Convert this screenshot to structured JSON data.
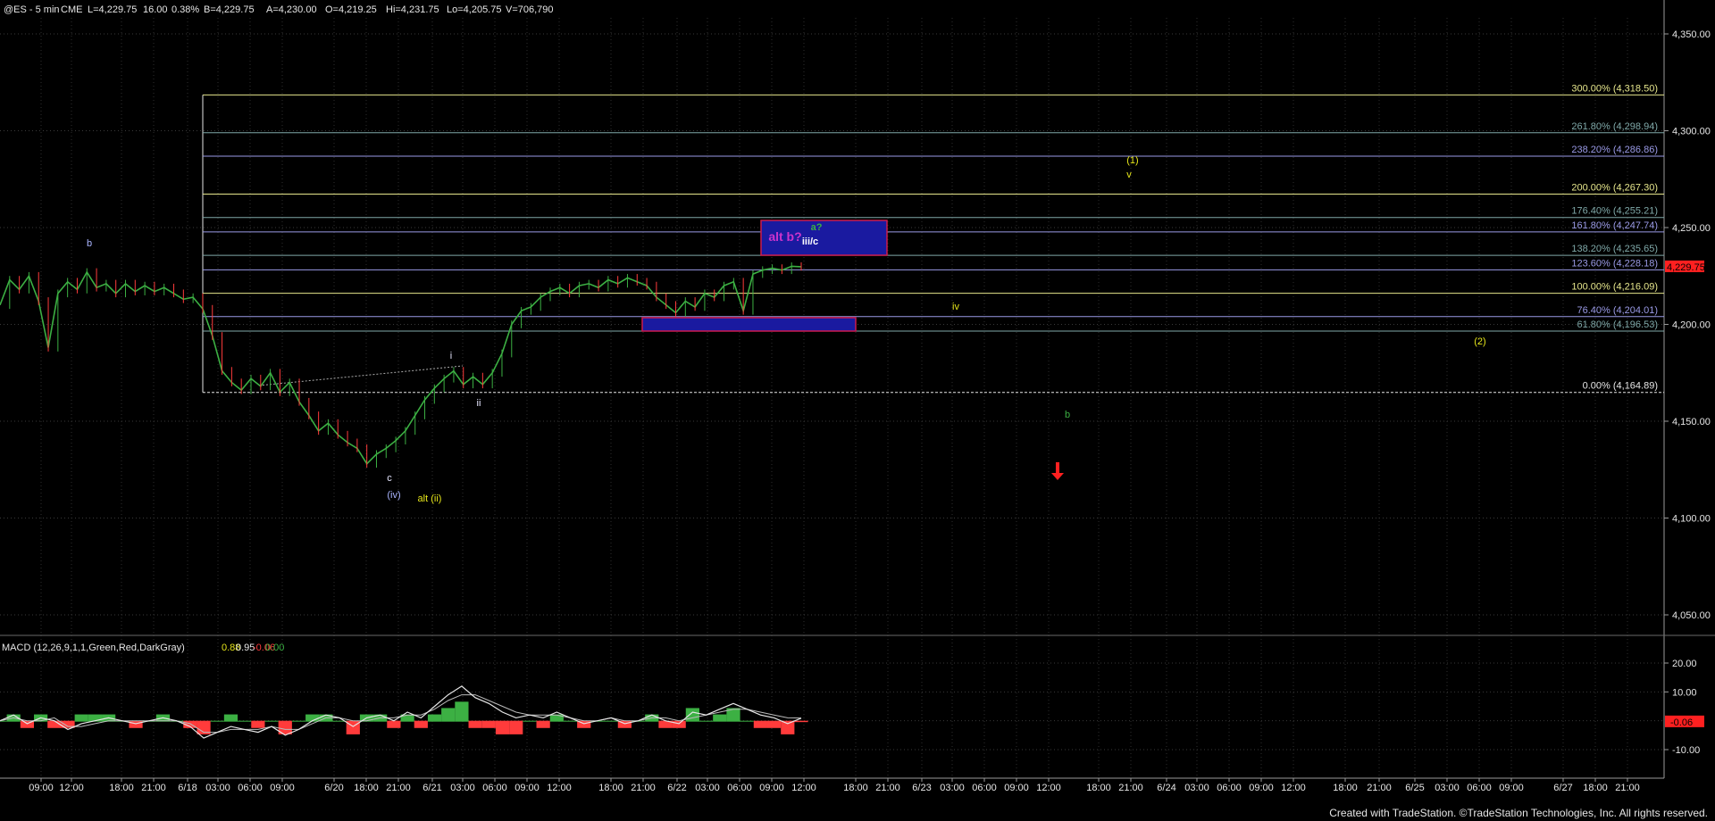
{
  "header": {
    "symbol": "@ES - 5 min",
    "exchange": "CME",
    "last": "L=4,229.75",
    "change": "16.00",
    "change_pct": "0.38%",
    "bid": "B=4,229.75",
    "ask": "A=4,230.00",
    "open": "O=4,219.25",
    "high": "Hi=4,231.75",
    "low": "Lo=4,205.75",
    "volume": "V=706,790"
  },
  "price_axis": {
    "ticks": [
      {
        "value": 4350,
        "label": "4,350.00"
      },
      {
        "value": 4300,
        "label": "4,300.00"
      },
      {
        "value": 4250,
        "label": "4,250.00"
      },
      {
        "value": 4200,
        "label": "4,200.00"
      },
      {
        "value": 4150,
        "label": "4,150.00"
      },
      {
        "value": 4100,
        "label": "4,100.00"
      },
      {
        "value": 4050,
        "label": "4,050.00"
      }
    ],
    "last_price_label": "4,229.75",
    "min": 4030,
    "max": 4370
  },
  "macd": {
    "title": "MACD (12,26,9,1,1,Green,Red,DarkGray)",
    "values": [
      "0.88",
      "0.95",
      "-0.06",
      "0.00"
    ],
    "value_colors": [
      "#e6e61a",
      "#e6e6e6",
      "#ff3b3b",
      "#3cb043"
    ],
    "ticks": [
      {
        "value": 20,
        "label": "20.00"
      },
      {
        "value": 10,
        "label": "10.00"
      },
      {
        "value": -10,
        "label": "-10.00"
      }
    ],
    "current_label": "-0.06",
    "min": -16,
    "max": 25
  },
  "time_axis": {
    "labels": [
      "09:00",
      "12:00",
      "18:00",
      "21:00",
      "6/18",
      "03:00",
      "06:00",
      "09:00",
      "6/20",
      "18:00",
      "21:00",
      "6/21",
      "03:00",
      "06:00",
      "09:00",
      "12:00",
      "18:00",
      "21:00",
      "6/22",
      "03:00",
      "06:00",
      "09:00",
      "12:00",
      "18:00",
      "21:00",
      "6/23",
      "03:00",
      "06:00",
      "09:00",
      "12:00",
      "18:00",
      "21:00",
      "6/24",
      "03:00",
      "06:00",
      "09:00",
      "12:00",
      "18:00",
      "21:00",
      "6/25",
      "03:00",
      "06:00",
      "09:00",
      "6/27",
      "18:00",
      "21:00"
    ]
  },
  "fib_levels": [
    {
      "label": "300.00% (4,318.50)",
      "value": 4318.5,
      "color": "#e6e68c"
    },
    {
      "label": "261.80% (4,298.94)",
      "value": 4298.94,
      "color": "#7fa8a8"
    },
    {
      "label": "238.20% (4,286.86)",
      "value": 4286.86,
      "color": "#9a9ae6"
    },
    {
      "label": "200.00% (4,267.30)",
      "value": 4267.3,
      "color": "#e6e68c"
    },
    {
      "label": "176.40% (4,255.21)",
      "value": 4255.21,
      "color": "#7fa8a8"
    },
    {
      "label": "161.80% (4,247.74)",
      "value": 4247.74,
      "color": "#9a9ae6"
    },
    {
      "label": "138.20% (4,235.65)",
      "value": 4235.65,
      "color": "#7fa8a8"
    },
    {
      "label": "123.60% (4,228.18)",
      "value": 4228.18,
      "color": "#9a9ae6"
    },
    {
      "label": "100.00% (4,216.09)",
      "value": 4216.09,
      "color": "#e6e68c"
    },
    {
      "label": "76.40% (4,204.01)",
      "value": 4204.01,
      "color": "#9a9ae6"
    },
    {
      "label": "61.80% (4,196.53)",
      "value": 4196.53,
      "color": "#7fa8a8"
    },
    {
      "label": "0.00% (4,164.89)",
      "value": 4164.89,
      "color": "#e6e6e6"
    }
  ],
  "wave_labels": [
    {
      "text": "b",
      "color": "#aab4ff"
    },
    {
      "text": "i",
      "color": "#e6e6ff"
    },
    {
      "text": "ii",
      "color": "#e6e6ff"
    },
    {
      "text": "c",
      "color": "#e6e6ff"
    },
    {
      "text": "(iv)",
      "color": "#aab4ff"
    },
    {
      "text": "alt (ii)",
      "color": "#e6e61a"
    },
    {
      "text": "a?",
      "color": "#3cb043"
    },
    {
      "text": "alt b?",
      "color": "#cc33cc"
    },
    {
      "text": "iii/c",
      "color": "#ffffff"
    },
    {
      "text": "iv",
      "color": "#e6e61a"
    },
    {
      "text": "(1)",
      "color": "#e6e61a"
    },
    {
      "text": "v",
      "color": "#e6e61a"
    },
    {
      "text": "(2)",
      "color": "#e6e61a"
    },
    {
      "text": "b",
      "color": "#3cb043"
    }
  ],
  "footer": {
    "credit": "Created with TradeStation. ©TradeStation Technologies, Inc. All rights reserved."
  },
  "colors": {
    "background": "#000000",
    "price": "#3cb043",
    "up_candle": "#3cb043",
    "down_candle": "#ff3b3b",
    "box_fill": "#1a1aa0",
    "box_border": "#cc1a4d",
    "arrow": "#ff2020",
    "last_price_box": "#ff2020"
  },
  "chart_data": [
    {
      "type": "line",
      "title": "@ES - 5 min",
      "x_labels_note": "",
      "series": [
        {
          "values": [
            4210,
            4223,
            4218,
            4225,
            4212,
            4188,
            4216,
            4222,
            4218,
            4227,
            4219,
            4221,
            4216,
            4221,
            4217,
            4220,
            4217,
            4219,
            4216,
            4213,
            4214,
            4208,
            4194,
            4176,
            4170,
            4166,
            4172,
            4168,
            4175,
            4165,
            4170,
            4160,
            4153,
            4145,
            4149,
            4143,
            4139,
            4136,
            4128,
            4133,
            4136,
            4140,
            4145,
            4153,
            4161,
            4167,
            4172,
            4176,
            4169,
            4173,
            4169,
            4175,
            4185,
            4200,
            4207,
            4209,
            4214,
            4217,
            4219,
            4216,
            4220,
            4221,
            4219,
            4223,
            4221,
            4224,
            4222,
            4220,
            4214,
            4210,
            4206,
            4212,
            4209,
            4216,
            4214,
            4220,
            4222,
            4207,
            4226,
            4228,
            4229,
            4228,
            4230,
            4229.75
          ]
        }
      ],
      "ylim": [
        4030,
        4370
      ]
    },
    {
      "type": "line",
      "title": "MACD (12,26,9,1,1,Green,Red,DarkGray)",
      "series": [
        {
          "values": [
            0,
            2,
            -1,
            1,
            0,
            -3,
            -1,
            0,
            1,
            0,
            -1,
            0,
            1,
            0,
            -2,
            -6,
            -4,
            -2,
            -3,
            -4,
            -2,
            -5,
            -3,
            0,
            2,
            1,
            -2,
            1,
            2,
            0,
            3,
            1,
            5,
            9,
            12,
            8,
            6,
            3,
            1,
            2,
            1,
            3,
            1,
            -1,
            0,
            1,
            -1,
            0,
            2,
            0,
            -1,
            3,
            2,
            4,
            6,
            4,
            2,
            1,
            -1,
            0.88
          ]
        },
        {
          "values": [
            0,
            1,
            0,
            0,
            1,
            -2,
            -2,
            -1,
            0,
            0,
            0,
            0,
            0,
            0,
            -1,
            -4,
            -4,
            -3,
            -3,
            -3,
            -2,
            -3,
            -3,
            -1,
            1,
            1,
            0,
            0,
            1,
            1,
            2,
            2,
            4,
            7,
            9,
            9,
            7,
            5,
            3,
            2,
            2,
            2,
            1,
            0,
            0,
            1,
            0,
            0,
            1,
            1,
            0,
            1,
            2,
            3,
            4,
            4,
            3,
            2,
            1,
            0.95
          ]
        }
      ],
      "ylim": [
        -16,
        25
      ]
    }
  ]
}
